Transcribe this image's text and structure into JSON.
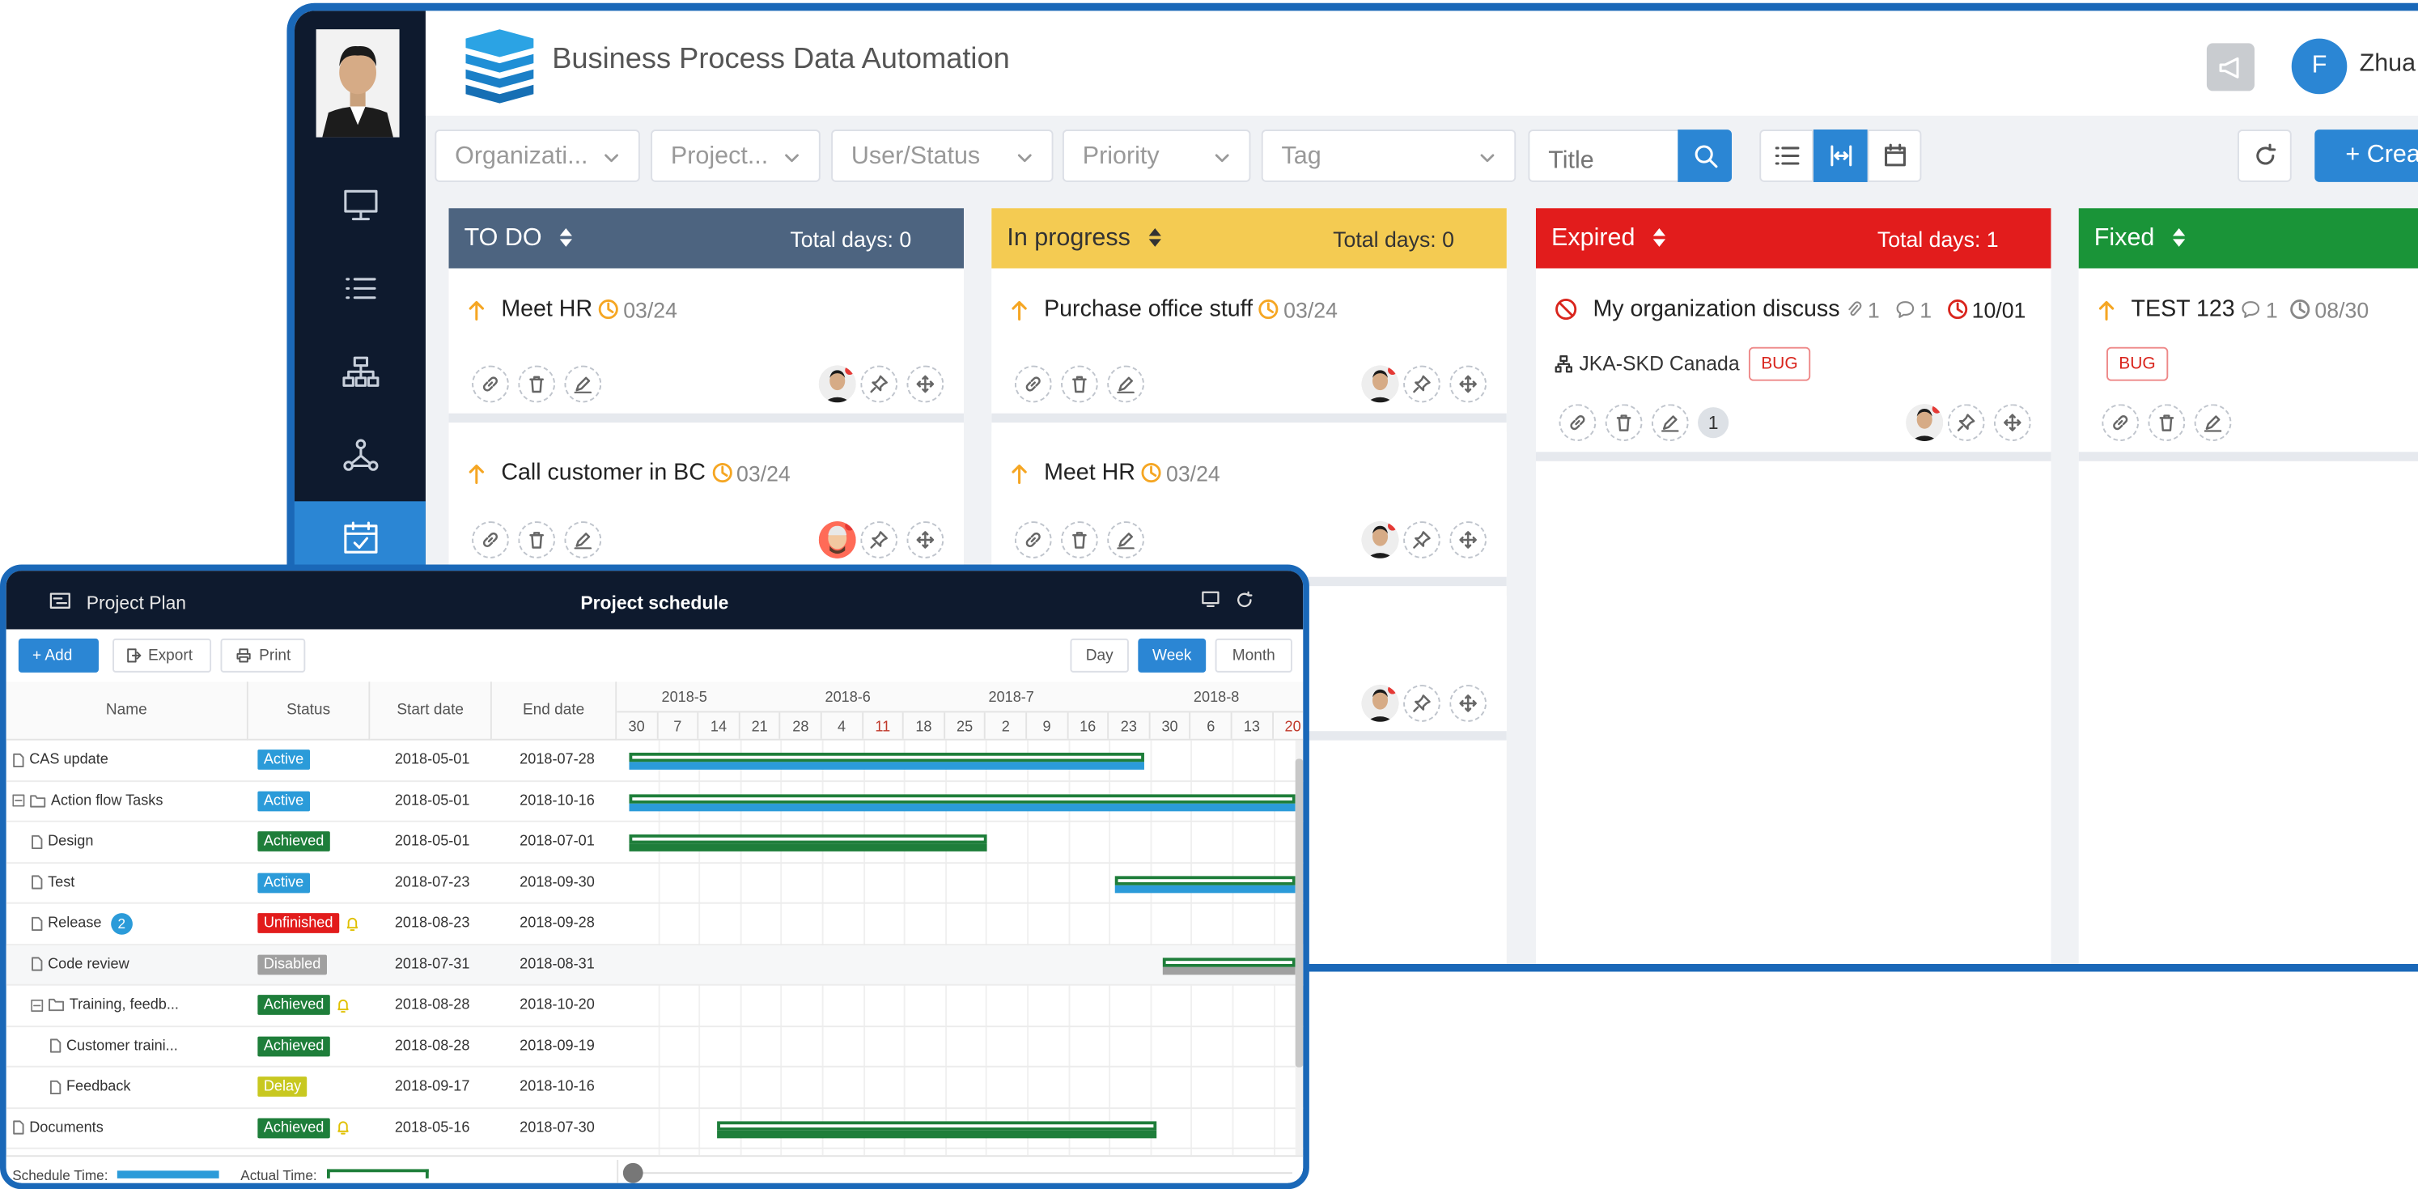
{
  "app": {
    "title": "Business Process Data Automation",
    "user_initial": "F",
    "user_name": "Zhua",
    "colors": {
      "blue": "#2b86d4",
      "sidebar": "#0e1a2e",
      "todo": "#4d6480",
      "progress": "#f4cb52",
      "expired": "#e21c1c",
      "fixed": "#1a9438"
    }
  },
  "sidebar": {
    "items": [
      {
        "icon": "monitor-icon"
      },
      {
        "icon": "list-icon"
      },
      {
        "icon": "org-chart-icon"
      },
      {
        "icon": "workflow-icon"
      },
      {
        "icon": "calendar-check-icon",
        "active": true
      }
    ]
  },
  "filters": {
    "organization": "Organizati...",
    "project": "Project...",
    "user_status": "User/Status",
    "priority": "Priority",
    "tag": "Tag",
    "title_placeholder": "Title",
    "create_label": "+ Crea"
  },
  "board": {
    "columns": [
      {
        "name": "TO DO",
        "total": "Total days: 0"
      },
      {
        "name": "In progress",
        "total": "Total days: 0"
      },
      {
        "name": "Expired",
        "total": "Total days: 1"
      },
      {
        "name": "Fixed",
        "total": ""
      }
    ],
    "cards": {
      "todo1": {
        "title": "Meet HR",
        "date": "03/24"
      },
      "todo2": {
        "title": "Call customer in BC",
        "date": "03/24"
      },
      "prog1": {
        "title": "Purchase office stuff",
        "date": "03/24"
      },
      "prog2": {
        "title": "Meet HR",
        "date": "03/24"
      },
      "exp1": {
        "title": "My organization discuss",
        "attachments": "1",
        "comments": "1",
        "date": "10/01",
        "org": "JKA-SKD Canada",
        "tag": "BUG",
        "count": "1"
      },
      "fix1": {
        "title": "TEST 123",
        "comments": "1",
        "date": "08/30",
        "tag": "BUG"
      }
    }
  },
  "gantt": {
    "panel_title": "Project Plan",
    "chart_title": "Project schedule",
    "toolbar": {
      "add": "+ Add",
      "export": "Export",
      "print": "Print",
      "day": "Day",
      "week": "Week",
      "month": "Month"
    },
    "columns": {
      "name": "Name",
      "status": "Status",
      "start": "Start date",
      "end": "End date"
    },
    "months": [
      "2018-5",
      "2018-6",
      "2018-7",
      "2018-8"
    ],
    "weeks": [
      "30",
      "7",
      "14",
      "21",
      "28",
      "4",
      "11",
      "18",
      "25",
      "2",
      "9",
      "16",
      "23",
      "30",
      "6",
      "13",
      "20"
    ],
    "status_colors": {
      "Active": "#2b9bd9",
      "Achieved": "#1e7e3a",
      "Unfinished": "#e21c1c",
      "Disabled": "#a0a0a0",
      "Delay": "#c8c820"
    },
    "rows": [
      {
        "name": "CAS update",
        "status": "Active",
        "start": "2018-05-01",
        "end": "2018-07-28"
      },
      {
        "name": "Action flow Tasks",
        "status": "Active",
        "start": "2018-05-01",
        "end": "2018-10-16"
      },
      {
        "name": "Design",
        "status": "Achieved",
        "start": "2018-05-01",
        "end": "2018-07-01"
      },
      {
        "name": "Test",
        "status": "Active",
        "start": "2018-07-23",
        "end": "2018-09-30"
      },
      {
        "name": "Release",
        "status": "Unfinished",
        "start": "2018-08-23",
        "end": "2018-09-28",
        "badge": "2"
      },
      {
        "name": "Code review",
        "status": "Disabled",
        "start": "2018-07-31",
        "end": "2018-08-31"
      },
      {
        "name": "Training, feedb...",
        "status": "Achieved",
        "start": "2018-08-28",
        "end": "2018-10-20"
      },
      {
        "name": "Customer traini...",
        "status": "Achieved",
        "start": "2018-08-28",
        "end": "2018-09-19"
      },
      {
        "name": "Feedback",
        "status": "Delay",
        "start": "2018-09-17",
        "end": "2018-10-16"
      },
      {
        "name": "Documents",
        "status": "Achieved",
        "start": "2018-05-16",
        "end": "2018-07-30"
      }
    ],
    "legend": {
      "schedule": "Schedule Time:",
      "actual": "Actual Time:"
    }
  }
}
